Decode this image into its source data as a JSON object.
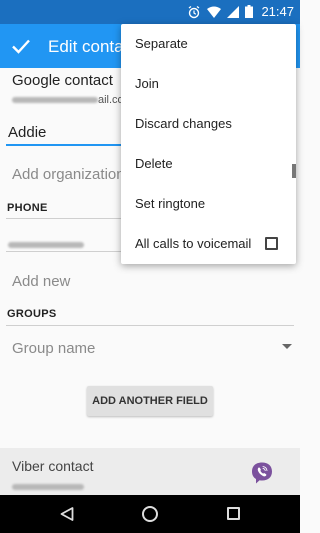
{
  "status_bar": {
    "time": "21:47",
    "icons": [
      "alarm-icon",
      "wifi-icon",
      "signal-icon",
      "battery-icon"
    ]
  },
  "app_bar": {
    "title": "Edit contact",
    "done_icon": "check-icon"
  },
  "account": {
    "title": "Google contact",
    "email_suffix": "ail.com"
  },
  "name_field": {
    "value": "Addie"
  },
  "organization_field": {
    "placeholder": "Add organization"
  },
  "phone": {
    "heading": "PHONE",
    "add_new_placeholder": "Add new"
  },
  "groups": {
    "heading": "GROUPS",
    "placeholder": "Group name"
  },
  "add_field_button": {
    "label": "ADD ANOTHER FIELD"
  },
  "viber": {
    "title": "Viber contact",
    "icon": "viber-icon"
  },
  "overflow_menu": {
    "items": [
      {
        "label": "Separate"
      },
      {
        "label": "Join"
      },
      {
        "label": "Discard changes"
      },
      {
        "label": "Delete"
      },
      {
        "label": "Set ringtone"
      },
      {
        "label": "All calls to voicemail",
        "checked": false
      }
    ]
  },
  "nav_bar": {
    "buttons": [
      "back-icon",
      "home-icon",
      "recents-icon"
    ]
  },
  "colors": {
    "status_bar": "#1b6fbf",
    "app_bar": "#2196f3",
    "accent": "#2196f3",
    "viber": "#7b519d"
  }
}
